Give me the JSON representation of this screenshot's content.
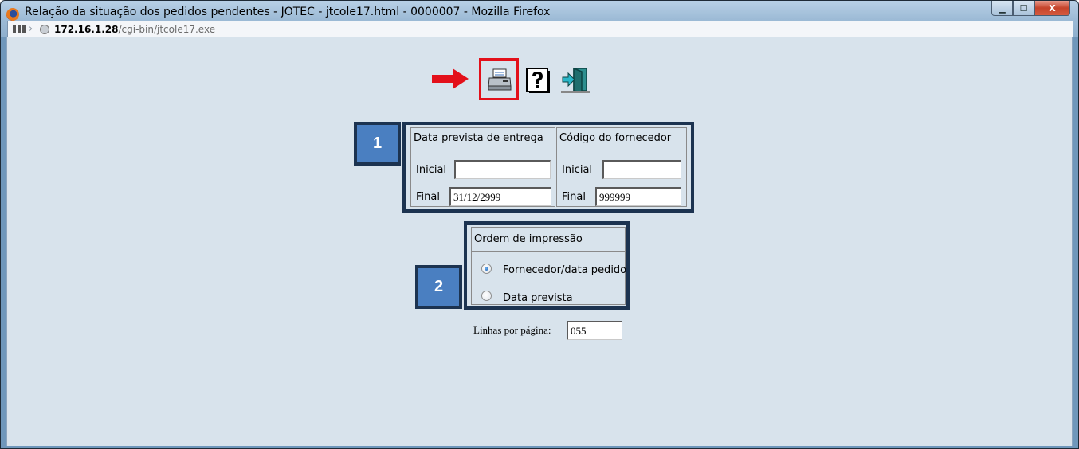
{
  "window": {
    "title": "Relação da situação dos pedidos pendentes - JOTEC - jtcole17.html - 0000007 - Mozilla Firefox",
    "buttons": {
      "minimize": "▁",
      "maximize": "☐",
      "close": "X"
    }
  },
  "address": {
    "host": "172.16.1.28",
    "path": "/cgi-bin/jtcole17.exe"
  },
  "toolbar": {
    "icons": [
      "printer-icon",
      "help-icon",
      "exit-icon"
    ],
    "highlight_color": "#e3101a"
  },
  "section1": {
    "badge": "1",
    "delivery": {
      "title": "Data prevista de entrega",
      "initial_label": "Inicial",
      "initial_value": "",
      "final_label": "Final",
      "final_value": "31/12/2999"
    },
    "supplier": {
      "title": "Código do fornecedor",
      "initial_label": "Inicial",
      "initial_value": "",
      "final_label": "Final",
      "final_value": "999999"
    }
  },
  "section2": {
    "badge": "2",
    "title": "Ordem de impressão",
    "options": [
      {
        "label": "Fornecedor/data pedido",
        "checked": true
      },
      {
        "label": "Data prevista",
        "checked": false
      }
    ]
  },
  "lines_per_page": {
    "label": "Linhas por página:",
    "value": "055"
  },
  "colors": {
    "panel_border": "#1c3350",
    "badge_fill": "#4a7fc1",
    "content_bg": "#d8e3ec"
  }
}
